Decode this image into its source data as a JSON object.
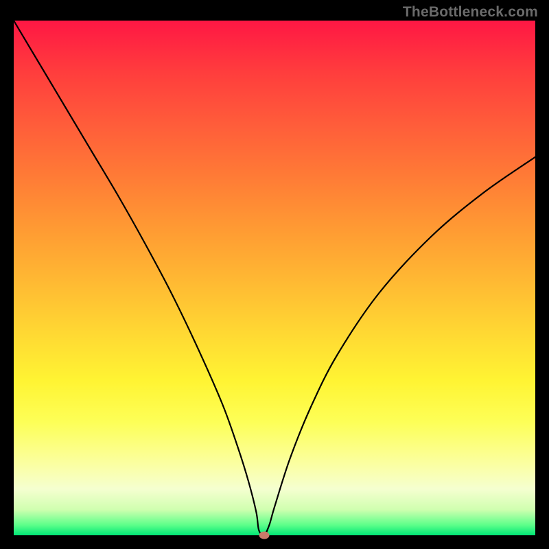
{
  "watermark": "TheBottleneck.com",
  "chart_data": {
    "type": "line",
    "title": "",
    "xlabel": "",
    "ylabel": "",
    "xlim": [
      0,
      100
    ],
    "ylim": [
      0,
      100
    ],
    "grid": false,
    "legend": false,
    "gradient_stops": [
      {
        "pct": 0,
        "color": "#ff1744"
      },
      {
        "pct": 50,
        "color": "#ffb733"
      },
      {
        "pct": 78,
        "color": "#fdff57"
      },
      {
        "pct": 100,
        "color": "#00e676"
      }
    ],
    "series": [
      {
        "name": "bottleneck-curve",
        "x": [
          0.0,
          5.0,
          10.0,
          15.0,
          20.0,
          25.0,
          30.0,
          35.0,
          40.0,
          43.0,
          45.0,
          46.5,
          47.0,
          48.0,
          49.0,
          50.0,
          53.0,
          57.0,
          62.0,
          70.0,
          80.0,
          90.0,
          100.0
        ],
        "values": [
          100,
          91.5,
          83.0,
          74.5,
          66.0,
          57.0,
          47.5,
          37.0,
          25.5,
          17.0,
          10.5,
          4.5,
          1.0,
          0.0,
          2.0,
          5.5,
          15.0,
          25.0,
          35.0,
          47.0,
          58.0,
          66.5,
          73.5
        ]
      }
    ],
    "marker": {
      "x": 48.0,
      "y": 0.0,
      "color": "#c97a6a"
    }
  }
}
